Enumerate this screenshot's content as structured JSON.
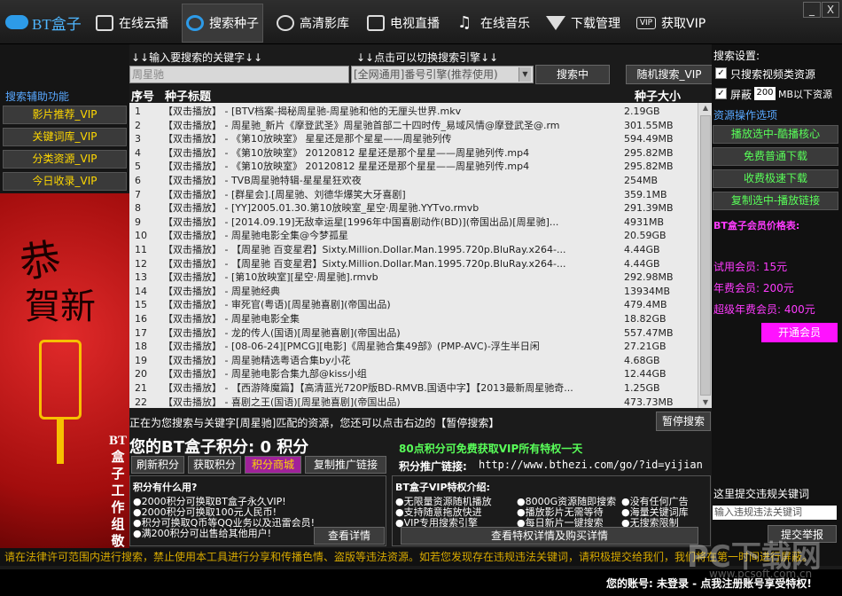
{
  "app": {
    "logo": "BT盒子",
    "minimize": "_",
    "close": "X"
  },
  "tabs": [
    {
      "label": "在线云播",
      "icon": "film-icon"
    },
    {
      "label": "搜索种子",
      "icon": "search-icon"
    },
    {
      "label": "高清影库",
      "icon": "reel-icon"
    },
    {
      "label": "电视直播",
      "icon": "tv-icon"
    },
    {
      "label": "在线音乐",
      "icon": "music-icon"
    },
    {
      "label": "下载管理",
      "icon": "download-icon"
    },
    {
      "label": "获取VIP",
      "icon": "vip-icon",
      "badge": "VIP"
    }
  ],
  "search": {
    "hint_keyword": "↓↓输入要搜索的关键字↓↓",
    "hint_engine": "↓↓点击可以切换搜索引擎↓↓",
    "keyword": "周星驰",
    "engine": "[全网通用]番号引擎(推荐使用)",
    "search_button": "搜索中",
    "random_button": "随机搜索_VIP"
  },
  "left": {
    "label": "搜索辅助功能",
    "buttons": [
      "影片推荐_VIP",
      "关键词库_VIP",
      "分类资源_VIP",
      "今日收录_VIP"
    ],
    "banner_text1": "恭",
    "banner_text2": "賀新",
    "banner_vertical": "BT盒子工作组敬"
  },
  "table": {
    "col_no": "序号",
    "col_title": "种子标题",
    "col_size": "种子大小",
    "rows": [
      {
        "n": "1",
        "t": "【双击播放】 - [BTV档案-揭秘周星驰-周星驰和他的无厘头世界.mkv",
        "s": "2.19GB"
      },
      {
        "n": "2",
        "t": "【双击播放】 - 周星驰_新片《摩登武圣》周星驰首部二十四时传_易域风情@摩登武圣@.rm",
        "s": "301.55MB"
      },
      {
        "n": "3",
        "t": "【双击播放】 - 《第10放映室》 星星还是那个星星——周星驰列传",
        "s": "594.49MB"
      },
      {
        "n": "4",
        "t": "【双击播放】 - 《第10放映室》 20120812 星星还是那个星星——周星驰列传.mp4",
        "s": "295.82MB"
      },
      {
        "n": "5",
        "t": "【双击播放】 - 《第10放映室》 20120812 星星还是那个星星——周星驰列传.mp4",
        "s": "295.82MB"
      },
      {
        "n": "6",
        "t": "【双击播放】 - TVB周星驰特辑-星星星狂欢夜",
        "s": "254MB"
      },
      {
        "n": "7",
        "t": "【双击播放】 - [群星会].[周星驰、刘德华爆笑大牙喜剧]",
        "s": "359.1MB"
      },
      {
        "n": "8",
        "t": "【双击播放】 - [YY]2005.01.30.第10放映室_星空·周星驰.YYTvo.rmvb",
        "s": "291.39MB"
      },
      {
        "n": "9",
        "t": "【双击播放】 - [2014.09.19]无敌幸运星[1996年中国喜剧动作(BD)](帝国出品)[周星驰]...",
        "s": "4931MB"
      },
      {
        "n": "10",
        "t": "【双击播放】 - 周星驰电影全集@今梦孤星",
        "s": "20.59GB"
      },
      {
        "n": "11",
        "t": "【双击播放】 - 【周星驰 百变星君】Sixty.Million.Dollar.Man.1995.720p.BluRay.x264-...",
        "s": "4.44GB"
      },
      {
        "n": "12",
        "t": "【双击播放】 - 【周星驰 百变星君】Sixty.Million.Dollar.Man.1995.720p.BluRay.x264-...",
        "s": "4.44GB"
      },
      {
        "n": "13",
        "t": "【双击播放】 - [第10放映室][星空·周星驰].rmvb",
        "s": "292.98MB"
      },
      {
        "n": "14",
        "t": "【双击播放】 - 周星驰经典",
        "s": "13934MB"
      },
      {
        "n": "15",
        "t": "【双击播放】 - 审死官(粤语)[周星驰喜剧](帝国出品)",
        "s": "479.4MB"
      },
      {
        "n": "16",
        "t": "【双击播放】 - 周星驰电影全集",
        "s": "18.82GB"
      },
      {
        "n": "17",
        "t": "【双击播放】 - 龙的传人(国语)[周星驰喜剧](帝国出品)",
        "s": "557.47MB"
      },
      {
        "n": "18",
        "t": "【双击播放】 - [08-06-24][PMCG][电影]《周星驰合集49部》(PMP-AVC)-浮生半日闲",
        "s": "27.21GB"
      },
      {
        "n": "19",
        "t": "【双击播放】 - 周星驰精选粤语合集by小花",
        "s": "4.68GB"
      },
      {
        "n": "20",
        "t": "【双击播放】 - 周星驰电影合集九部@kiss小组",
        "s": "12.44GB"
      },
      {
        "n": "21",
        "t": "【双击播放】 - 【西游降魔篇】【高清蓝光720P版BD-RMVB.国语中字】【2013最新周星驰奇...",
        "s": "1.25GB"
      },
      {
        "n": "22",
        "t": "【双击播放】 - 喜剧之王(国语)[周星驰喜剧](帝国出品)",
        "s": "473.73MB"
      }
    ]
  },
  "status": {
    "text": "正在为您搜索与关键字[周星驰]匹配的资源，您还可以点击右边的【暂停搜索】",
    "pause_button": "暂停搜索"
  },
  "points": {
    "score_line": "您的BT盒子积分: 0 积分",
    "promo": "80点积分可免费获取VIP所有特权一天",
    "refresh": "刷新积分",
    "get": "获取积分",
    "mall": "积分商城",
    "copy": "复制推广链接",
    "link_label": "积分推广链接:",
    "link_url": "http://www.bthezi.com/go/?id=yijian"
  },
  "box1": {
    "title": "积分有什么用?",
    "items": [
      "●2000积分可换取BT盒子永久VIP!",
      "●2000积分可换取100元人民币!",
      "●积分可换取Q币等QQ业务以及迅雷会员!",
      "●满200积分可出售给其他用户!"
    ],
    "button": "查看详情"
  },
  "box2": {
    "title": "BT盒子VIP特权介绍:",
    "items": [
      "●无限量资源随机播放",
      "●8000G资源随即搜索",
      "●没有任何广告",
      "●支持随意拖放快进",
      "●播放影片无需等待",
      "●海量关键词库",
      "●VIP专用搜索引擎",
      "●每日新片一键搜索",
      "●无搜索限制"
    ],
    "button": "查看特权详情及购买详情"
  },
  "right": {
    "title": "搜索设置:",
    "opt1": "只搜索视频类资源",
    "opt2_pre": "屏蔽",
    "opt2_value": "200",
    "opt2_post": "MB以下资源",
    "ops_label": "资源操作选项",
    "buttons": [
      "播放选中-酷播核心",
      "免费普通下载",
      "收费极速下载",
      "复制选中-播放链接"
    ],
    "price_title": "BT盒子会员价格表:",
    "prices": [
      "试用会员: 15元",
      "年费会员: 200元",
      "超级年费会员: 400元"
    ],
    "open_button": "开通会员",
    "report_label": "这里提交违规关键词",
    "report_placeholder": "输入违规违法关键词",
    "report_button": "提交举报"
  },
  "ticker": "请在法律许可范围内进行搜索，禁止使用本工具进行分享和传播色情、盗版等违法资源。如若您发现存在违规违法关键词，请积极提交给我们，我们将在第一时间进行屏蔽。",
  "account": "您的账号: 未登录 - 点我注册账号享受特权!",
  "watermark": "PC下载网",
  "watermark_url": "www.pcsoft.com.cn",
  "colors": {
    "accent_blue": "#59a8ff",
    "vip_yellow": "#ffd800",
    "green": "#59ff59",
    "magenta": "#ff12ff"
  }
}
